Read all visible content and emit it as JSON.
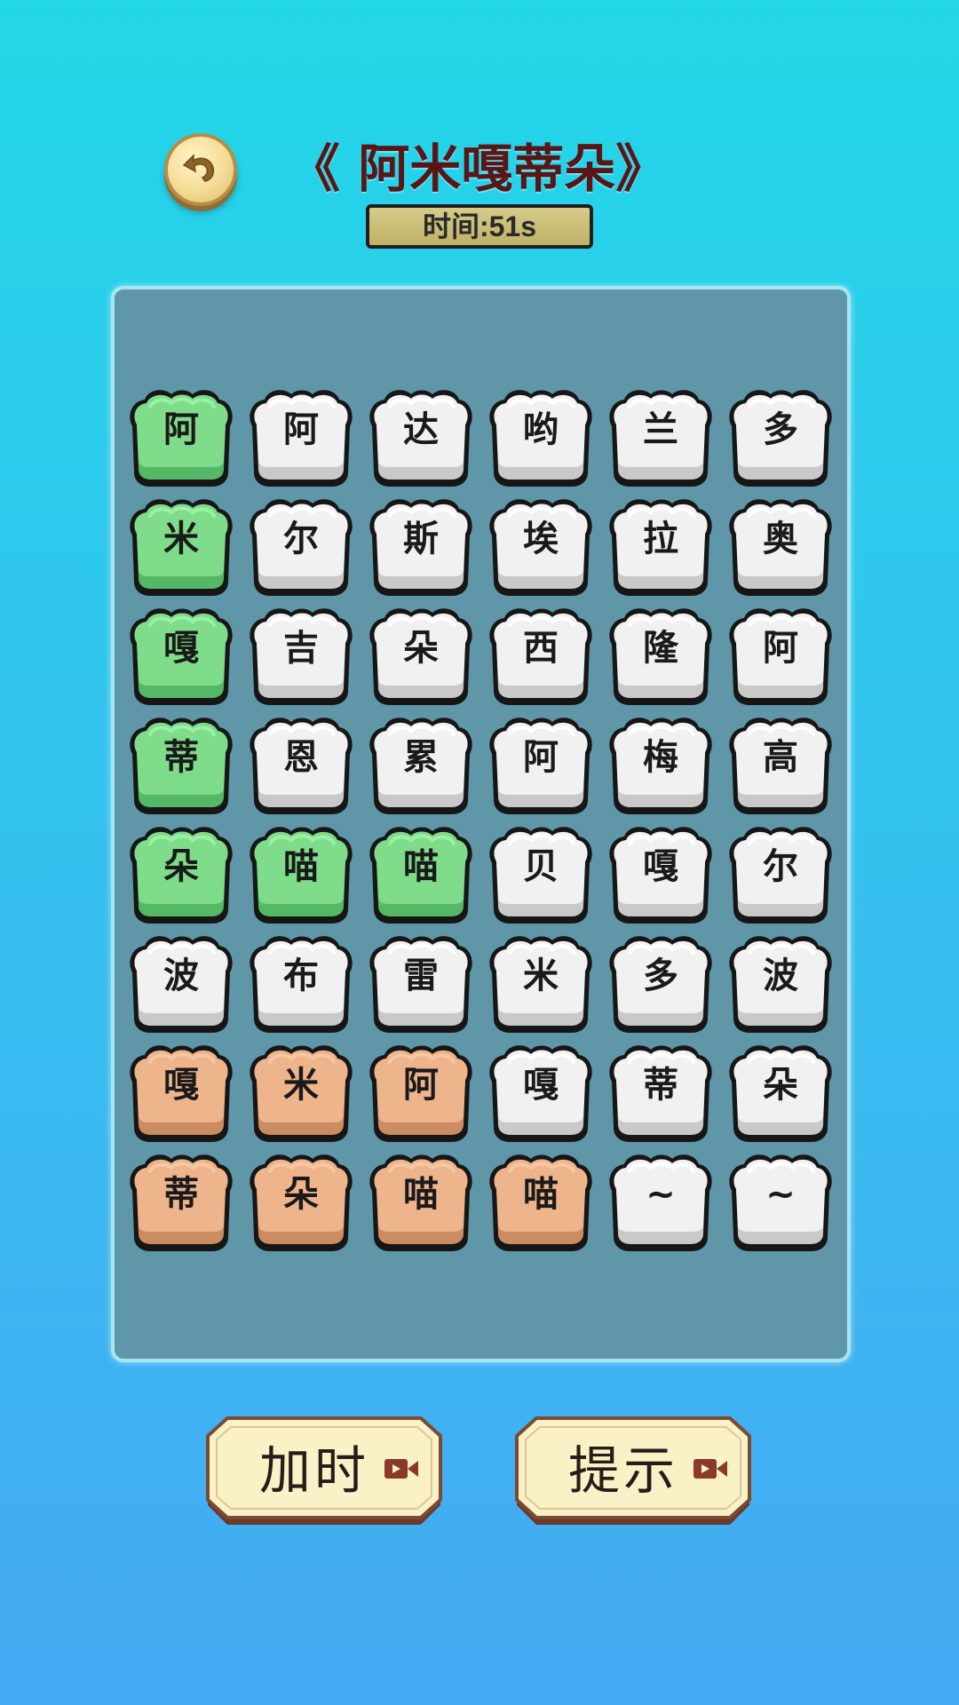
{
  "header": {
    "title": "《 阿米嘎蒂朵》",
    "timer": "时间:51s"
  },
  "icons": {
    "back": "back-arrow-icon",
    "video": "video-camera-icon"
  },
  "colors": {
    "tile_green": "#8ee89a",
    "tile_white": "#f4f4f4",
    "tile_orange": "#eeb48c",
    "board_bg": "#5f97a8",
    "title_color": "#5a1616"
  },
  "grid": {
    "rows": [
      [
        {
          "char": "阿",
          "state": "green"
        },
        {
          "char": "阿",
          "state": "white"
        },
        {
          "char": "达",
          "state": "white"
        },
        {
          "char": "哟",
          "state": "white"
        },
        {
          "char": "兰",
          "state": "white"
        },
        {
          "char": "多",
          "state": "white"
        }
      ],
      [
        {
          "char": "米",
          "state": "green"
        },
        {
          "char": "尔",
          "state": "white"
        },
        {
          "char": "斯",
          "state": "white"
        },
        {
          "char": "埃",
          "state": "white"
        },
        {
          "char": "拉",
          "state": "white"
        },
        {
          "char": "奥",
          "state": "white"
        }
      ],
      [
        {
          "char": "嘎",
          "state": "green"
        },
        {
          "char": "吉",
          "state": "white"
        },
        {
          "char": "朵",
          "state": "white"
        },
        {
          "char": "西",
          "state": "white"
        },
        {
          "char": "隆",
          "state": "white"
        },
        {
          "char": "阿",
          "state": "white"
        }
      ],
      [
        {
          "char": "蒂",
          "state": "green"
        },
        {
          "char": "恩",
          "state": "white"
        },
        {
          "char": "累",
          "state": "white"
        },
        {
          "char": "阿",
          "state": "white"
        },
        {
          "char": "梅",
          "state": "white"
        },
        {
          "char": "高",
          "state": "white"
        }
      ],
      [
        {
          "char": "朵",
          "state": "green"
        },
        {
          "char": "喵",
          "state": "green"
        },
        {
          "char": "喵",
          "state": "green"
        },
        {
          "char": "贝",
          "state": "white"
        },
        {
          "char": "嘎",
          "state": "white"
        },
        {
          "char": "尔",
          "state": "white"
        }
      ],
      [
        {
          "char": "波",
          "state": "white"
        },
        {
          "char": "布",
          "state": "white"
        },
        {
          "char": "雷",
          "state": "white"
        },
        {
          "char": "米",
          "state": "white"
        },
        {
          "char": "多",
          "state": "white"
        },
        {
          "char": "波",
          "state": "white"
        }
      ],
      [
        {
          "char": "嘎",
          "state": "orange"
        },
        {
          "char": "米",
          "state": "orange"
        },
        {
          "char": "阿",
          "state": "orange"
        },
        {
          "char": "嘎",
          "state": "white"
        },
        {
          "char": "蒂",
          "state": "white"
        },
        {
          "char": "朵",
          "state": "white"
        }
      ],
      [
        {
          "char": "蒂",
          "state": "orange"
        },
        {
          "char": "朵",
          "state": "orange"
        },
        {
          "char": "喵",
          "state": "orange"
        },
        {
          "char": "喵",
          "state": "orange"
        },
        {
          "char": "~",
          "state": "white"
        },
        {
          "char": "~",
          "state": "white"
        }
      ]
    ]
  },
  "buttons": {
    "add_time": "加时",
    "hint": "提示"
  }
}
